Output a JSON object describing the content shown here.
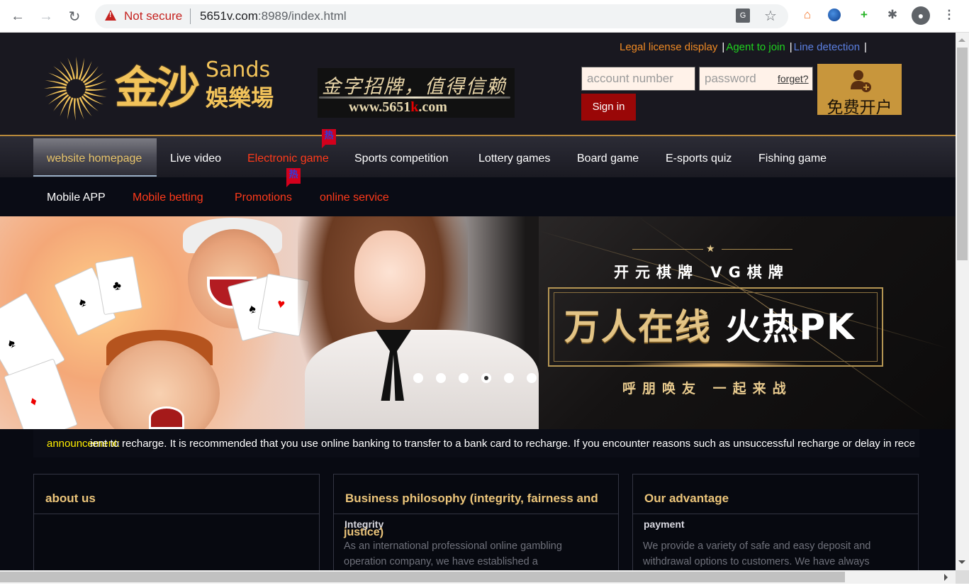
{
  "browser": {
    "security_label": "Not secure",
    "url_host": "5651v.com",
    "url_rest": ":8989/index.html",
    "icons": [
      "back-icon",
      "forward-icon",
      "reload-icon",
      "warning-icon",
      "translate-icon",
      "star-icon",
      "extension-house-icon",
      "extension-globe-icon",
      "extension-plus-icon",
      "extensions-puzzle-icon",
      "profile-icon",
      "menu-icon"
    ]
  },
  "header": {
    "logo": {
      "cn": "金沙",
      "en": "Sands",
      "cn2": "娛樂場"
    },
    "slogan": {
      "cn": "金字招牌，值得信赖",
      "url_prefix": "www.5651",
      "url_k": "k",
      "url_suffix": ".com"
    },
    "top_links": [
      {
        "label": "Legal license display",
        "color": "#f08a24"
      },
      {
        "label": "Agent to join",
        "color": "#1fd21f"
      },
      {
        "label": "Line detection",
        "color": "#5b7fe0"
      }
    ],
    "top_link_separator": "|",
    "login": {
      "account_placeholder": "account number",
      "password_placeholder": "password",
      "forget_label": "forget?",
      "signin_label": "Sign in"
    },
    "register_label": "免费开户"
  },
  "nav": {
    "row1": [
      {
        "label": "website homepage",
        "color": "#e8c46a",
        "active": true
      },
      {
        "label": "Live video",
        "color": "#ffffff"
      },
      {
        "label": "Electronic game",
        "color": "#ff3a1a",
        "hot": true
      },
      {
        "label": "Sports competition",
        "color": "#ffffff"
      },
      {
        "label": "Lottery games",
        "color": "#ffffff"
      },
      {
        "label": "Board game",
        "color": "#ffffff"
      },
      {
        "label": "E-sports quiz",
        "color": "#ffffff"
      },
      {
        "label": "Fishing game",
        "color": "#ffffff"
      }
    ],
    "row2": [
      {
        "label": "Mobile APP",
        "color": "#ffffff"
      },
      {
        "label": "Mobile betting",
        "color": "#ff3a1a"
      },
      {
        "label": "Promotions",
        "color": "#ff3a1a",
        "hot": true
      },
      {
        "label": "online service",
        "color": "#ff3a1a"
      }
    ],
    "hot_badge": "热"
  },
  "banner": {
    "line1": "开元棋牌  VG棋牌",
    "main_gold": "万人在线",
    "main_white": "火热PK",
    "line2": "呼朋唤友  一起来战",
    "slide_count": 6,
    "active_slide": 4
  },
  "announcement": {
    "label": "announcement:",
    "text": "ient to recharge. It is recommended that you use online banking to transfer to a bank card to recharge. If you encounter reasons such as unsuccessful recharge or delay in rece"
  },
  "panels": [
    {
      "title": "about us"
    },
    {
      "title": "Business philosophy (integrity, fairness and",
      "title_overflow": "justice)",
      "subtitle": "Integrity",
      "body": "As an international professional online gambling operation company, we have established a"
    },
    {
      "title": "Our advantage",
      "subtitle": "payment",
      "body": "We provide a variety of safe and easy deposit and withdrawal options to customers. We have always"
    }
  ]
}
